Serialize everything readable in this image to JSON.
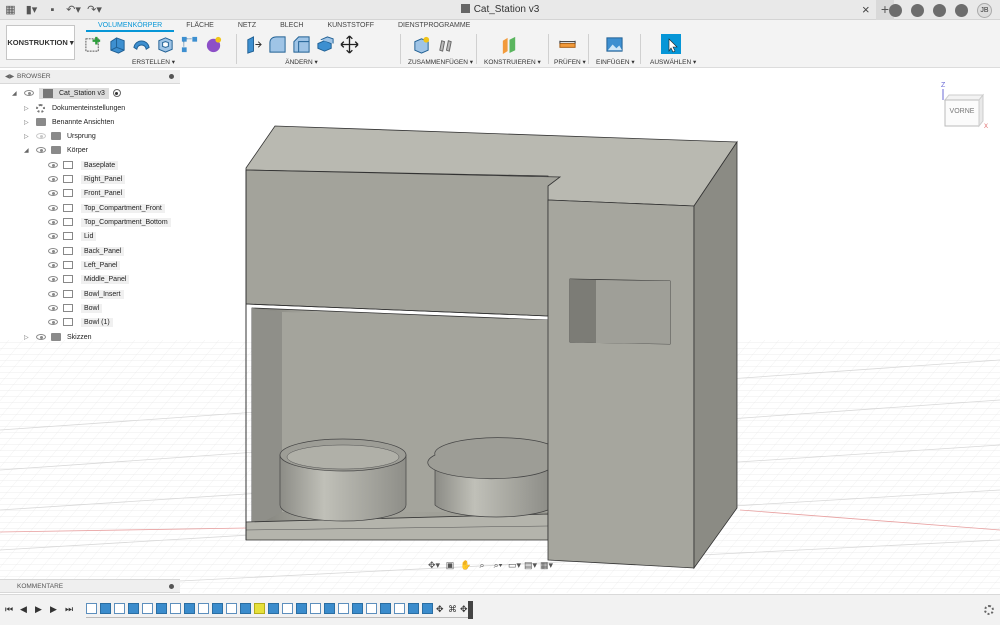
{
  "titlebar": {
    "doc_title": "Cat_Station v3",
    "user_initials": "JB"
  },
  "toolbar": {
    "workspace": "KONSTRUKTION",
    "tabs": [
      "VOLUMENKÖRPER",
      "FLÄCHE",
      "NETZ",
      "BLECH",
      "KUNSTSTOFF",
      "DIENSTPROGRAMME"
    ],
    "groups": {
      "erstellen": "ERSTELLEN",
      "aendern": "ÄNDERN",
      "zusammenfuegen": "ZUSAMMENFÜGEN",
      "konstruieren": "KONSTRUIEREN",
      "pruefen": "PRÜFEN",
      "einfuegen": "EINFÜGEN",
      "auswaehlen": "AUSWÄHLEN"
    }
  },
  "browser": {
    "title": "BROWSER",
    "root": "Cat_Station v3",
    "items": {
      "dokumenteinstellungen": "Dokumenteinstellungen",
      "benannte_ansichten": "Benannte Ansichten",
      "ursprung": "Ursprung",
      "koerper": "Körper",
      "skizzen": "Skizzen"
    },
    "bodies": [
      "Baseplate",
      "Right_Panel",
      "Front_Panel",
      "Top_Compartment_Front",
      "Top_Compartment_Bottom",
      "Lid",
      "Back_Panel",
      "Left_Panel",
      "Middle_Panel",
      "Bowl_Insert",
      "Bowl",
      "Bowl (1)"
    ]
  },
  "viewcube": {
    "face_label": "VORNE",
    "axis_z": "Z",
    "axis_x": "X"
  },
  "comments": {
    "title": "KOMMENTARE"
  },
  "colors": {
    "accent": "#0696d7",
    "model": "#a4a49b",
    "highlight_feature": "#e6e03a"
  }
}
